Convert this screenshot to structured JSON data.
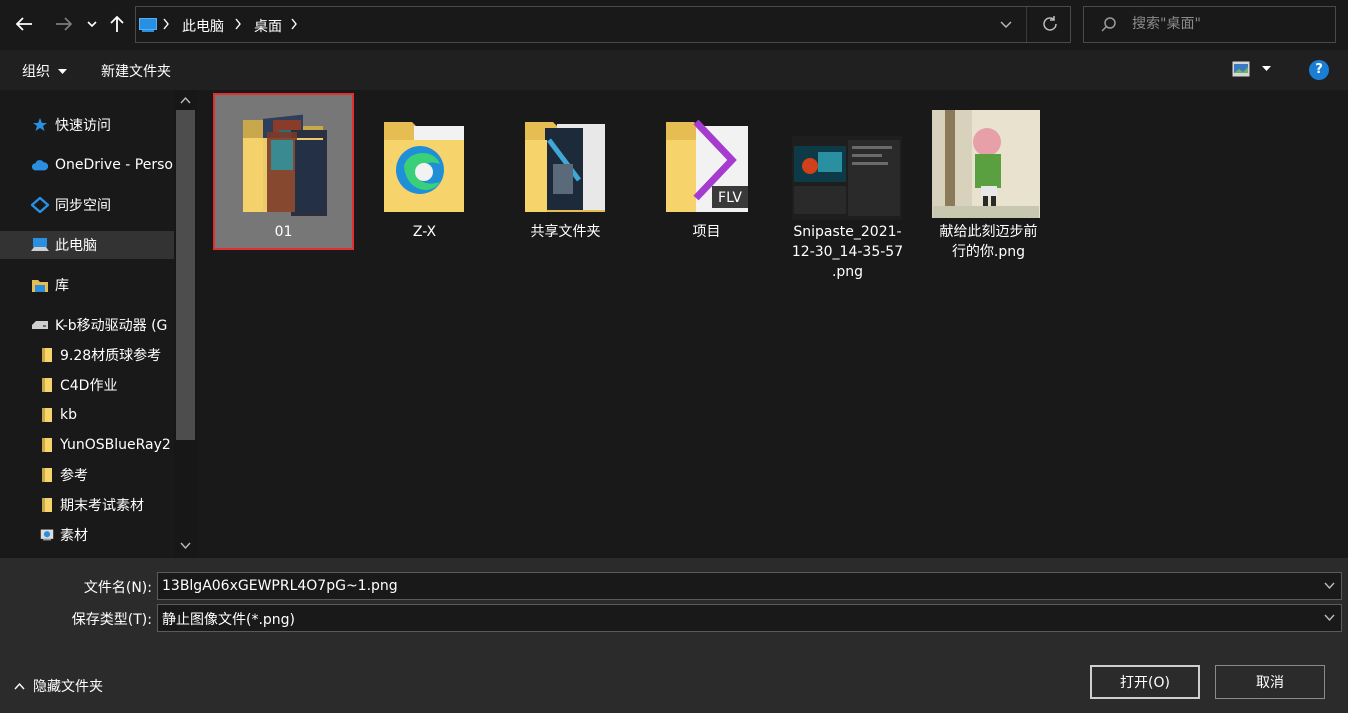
{
  "address": {
    "crumbs": [
      "此电脑",
      "桌面"
    ]
  },
  "search": {
    "placeholder": "搜索\"桌面\""
  },
  "toolbar": {
    "organize": "组织",
    "new_folder": "新建文件夹",
    "help": "?"
  },
  "nav": {
    "items": [
      {
        "label": "快速访问",
        "icon": "star-icon",
        "indent": 0
      },
      {
        "label": "OneDrive - Perso",
        "icon": "cloud-icon",
        "indent": 0
      },
      {
        "label": "同步空间",
        "icon": "sync-space-icon",
        "indent": 0
      },
      {
        "label": "此电脑",
        "icon": "computer-icon",
        "indent": 0
      },
      {
        "label": "库",
        "icon": "library-icon",
        "indent": 0
      },
      {
        "label": "K-b移动驱动器 (G",
        "icon": "drive-icon",
        "indent": 0
      },
      {
        "label": "9.28材质球参考",
        "icon": "folder-icon",
        "indent": 1
      },
      {
        "label": "C4D作业",
        "icon": "folder-icon",
        "indent": 1
      },
      {
        "label": "kb",
        "icon": "folder-icon",
        "indent": 1
      },
      {
        "label": "YunOSBlueRay2",
        "icon": "folder-icon",
        "indent": 1
      },
      {
        "label": "参考",
        "icon": "folder-icon",
        "indent": 1
      },
      {
        "label": "期末考试素材",
        "icon": "folder-icon",
        "indent": 1
      },
      {
        "label": "素材",
        "icon": "image-folder-icon",
        "indent": 1
      }
    ]
  },
  "files": [
    {
      "name": "01",
      "type": "folder"
    },
    {
      "name": "Z-X",
      "type": "folder"
    },
    {
      "name": "共享文件夹",
      "type": "folder"
    },
    {
      "name": "项目",
      "type": "folder"
    },
    {
      "name": "Snipaste_2021-12-30_14-35-57.png",
      "line1": "Snipaste_2021-",
      "line2": "12-30_14-35-57",
      "line3": ".png",
      "type": "image"
    },
    {
      "name": "献给此刻迈步前行的你.png",
      "line1": "献给此刻迈步前",
      "line2": "行的你.png",
      "type": "image"
    }
  ],
  "bottom": {
    "filename_label": "文件名(N):",
    "filename_value": "13BlgA06xGEWPRL4O7pG~1.png",
    "filetype_label": "保存类型(T):",
    "filetype_value": "静止图像文件(*.png)",
    "hide_folders": "隐藏文件夹",
    "open_button": "打开(O)",
    "cancel_button": "取消"
  },
  "colors": {
    "accent": "#1a7fd4",
    "selection_outline": "#e03030",
    "folder_yellow": "#f7d36b"
  }
}
